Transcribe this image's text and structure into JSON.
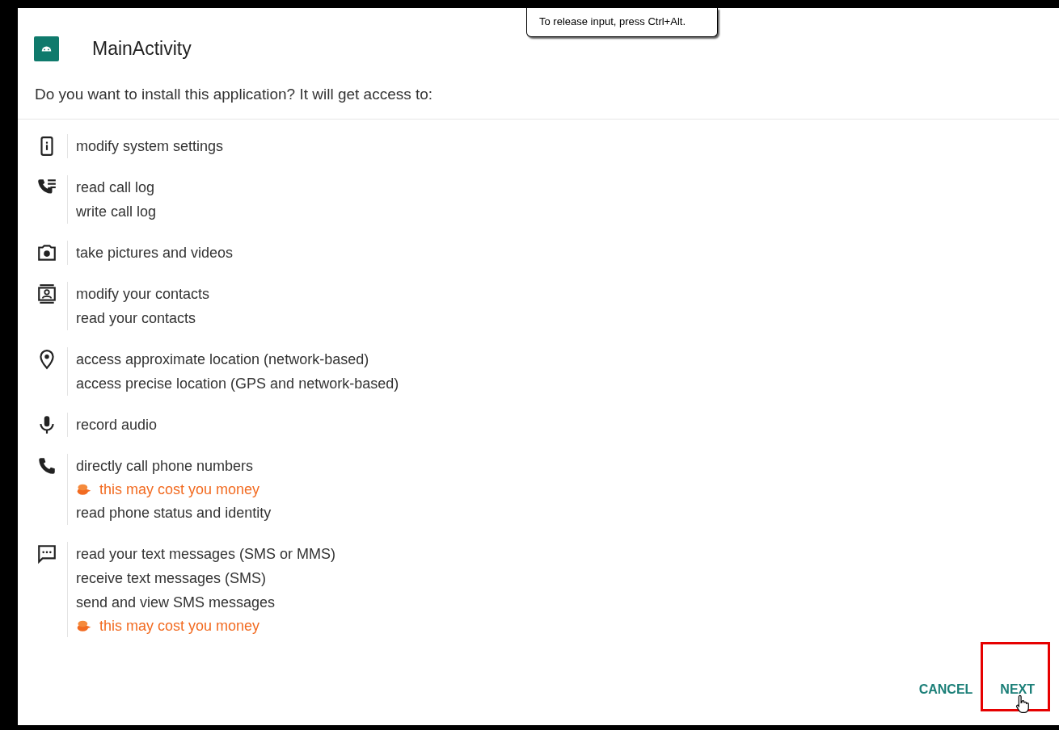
{
  "tooltip": "To release input, press Ctrl+Alt.",
  "dialog": {
    "title": "MainActivity",
    "prompt": "Do you want to install this application? It will get access to:",
    "permissions": [
      {
        "kind": "system",
        "lines": [
          {
            "kind": "permission",
            "text": "modify system settings"
          }
        ]
      },
      {
        "kind": "call_log",
        "lines": [
          {
            "kind": "permission",
            "text": "read call log"
          },
          {
            "kind": "permission",
            "text": "write call log"
          }
        ]
      },
      {
        "kind": "camera",
        "lines": [
          {
            "kind": "permission",
            "text": "take pictures and videos"
          }
        ]
      },
      {
        "kind": "contacts",
        "lines": [
          {
            "kind": "permission",
            "text": "modify your contacts"
          },
          {
            "kind": "permission",
            "text": "read your contacts"
          }
        ]
      },
      {
        "kind": "location",
        "lines": [
          {
            "kind": "permission",
            "text": "access approximate location (network-based)"
          },
          {
            "kind": "permission",
            "text": "access precise location (GPS and network-based)"
          }
        ]
      },
      {
        "kind": "microphone",
        "lines": [
          {
            "kind": "permission",
            "text": "record audio"
          }
        ]
      },
      {
        "kind": "phone",
        "lines": [
          {
            "kind": "permission",
            "text": "directly call phone numbers"
          },
          {
            "kind": "cost_warning",
            "text": "this may cost you money"
          },
          {
            "kind": "permission",
            "text": "read phone status and identity"
          }
        ]
      },
      {
        "kind": "sms",
        "lines": [
          {
            "kind": "permission",
            "text": "read your text messages (SMS or MMS)"
          },
          {
            "kind": "permission",
            "text": "receive text messages (SMS)"
          },
          {
            "kind": "permission",
            "text": "send and view SMS messages"
          },
          {
            "kind": "cost_warning",
            "text": "this may cost you money"
          }
        ]
      }
    ],
    "buttons": [
      {
        "label": "CANCEL",
        "highlighted": false
      },
      {
        "label": "NEXT",
        "highlighted": true
      }
    ]
  }
}
